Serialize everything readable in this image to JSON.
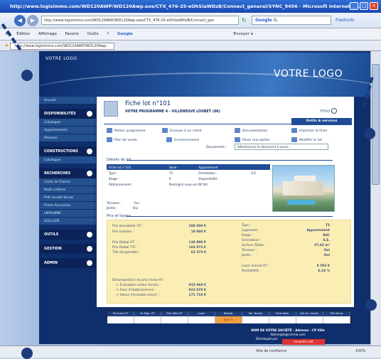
{
  "window": {
    "title": "http://www.logisimmo.com/WD120AWP/WD120Awp.exe/CTX_476-25-eOhSiaWDzB/Connect_general/SYNC_9456 - Microsoft Internet Ex..."
  },
  "nav": {
    "address": "http://www.logisimmo.com/WD120AWP/WD120Awp.exe/CTX_476-25-eOhSiaWDzB/Connect_gen",
    "search_engine": "Google",
    "search_placeholder": "G-",
    "envoyer_label": "Envoyer à",
    "freetools": "freetools"
  },
  "menu": {
    "items": [
      "Édition",
      "Affichage",
      "Favoris",
      "Outils",
      "?"
    ],
    "first": "E"
  },
  "favbar": {
    "tab": "http://www.logisimmo.com/WD120AWP/WD120Awp..."
  },
  "header": {
    "logo_left": "VOTRE LOGO",
    "logo_right": "VOTRE LOGO"
  },
  "sidebar": [
    {
      "type": "item",
      "label": "Accueil"
    },
    {
      "type": "head",
      "label": "DISPONIBILITÉS"
    },
    {
      "type": "item",
      "label": "Catalogue"
    },
    {
      "type": "item",
      "label": "Appartements"
    },
    {
      "type": "item",
      "label": "Maisons"
    },
    {
      "type": "head",
      "label": "CONSTRUCTIONS"
    },
    {
      "type": "item",
      "label": "Catalogue"
    },
    {
      "type": "head",
      "label": "RECHERCHES"
    },
    {
      "type": "item",
      "label": "Carte de France"
    },
    {
      "type": "item",
      "label": "Multi-critères"
    },
    {
      "type": "item",
      "label": "Prêt Locatif Social"
    },
    {
      "type": "item",
      "label": "Primo Accession"
    },
    {
      "type": "item",
      "label": "LMP/LMNP"
    },
    {
      "type": "item",
      "label": "SCELLIER"
    },
    {
      "type": "head",
      "label": "OUTILS"
    },
    {
      "type": "head",
      "label": "GESTION"
    },
    {
      "type": "head",
      "label": "ADMIN"
    }
  ],
  "fiche": {
    "title": "Fiche lot n°101",
    "subtitle": "VOTRE PROGRAMME 4 - VILLENEUVE LOUBET (06)",
    "retour": "retour"
  },
  "outils": {
    "title": "Outils & services",
    "actions": [
      "Retour programme",
      "Envoyer à un client",
      "Documentation",
      "Imprimer la fiche",
      "Plan de vente",
      "Environnement",
      "Poser une option",
      "Modifier le lot"
    ],
    "documents_label": "Documents :",
    "documents_select": "Sélectionnez le document à ouvrir..."
  },
  "details": {
    "title": "Détails du lot",
    "head": [
      "Fiche lot n°101",
      "Serie :",
      "Appartement"
    ],
    "rows": [
      [
        "Type :",
        "T3",
        "Orientation :",
        "S.E."
      ],
      [
        "Etage :",
        "0",
        "Disponibilité :",
        ""
      ],
      [
        "Stationnement :",
        "Parking(s) sous-sol (N°44)",
        "",
        ""
      ]
    ],
    "extra": [
      [
        "Terrasse :",
        "Oui"
      ],
      [
        "Jardin :",
        "Oui"
      ]
    ]
  },
  "prix": {
    "title": "Prix et loyers",
    "left": [
      [
        "Prix Immobilier HT :",
        "108 000 €"
      ],
      [
        "Prix mobilier :",
        "10 000 €"
      ],
      [
        "Prix Global HT :",
        "118 000 €"
      ],
      [
        "Prix Global TTC :",
        "163 873 €"
      ],
      [
        "TVA récupérable :",
        "63 373 €"
      ]
    ],
    "right": [
      [
        "Type :",
        "T3"
      ],
      [
        "Logement :",
        "Appartement"
      ],
      [
        "Etage :",
        "RdC"
      ],
      [
        "Orientation :",
        "S.E."
      ],
      [
        "Surface Totale :",
        "67,62 m²"
      ],
      [
        "Terrasse :",
        "Oui"
      ],
      [
        "Jardin :",
        "Oui"
      ],
      [
        "Loyer annuel HT :",
        "8 502 €"
      ],
      [
        "Rentabilité :",
        "6,24 %"
      ]
    ],
    "decomp_title": "Décomposition du prix immo HT :",
    "decomp": [
      [
        "-> Evaluation valeur terrain :",
        "915 068 €"
      ],
      [
        "-> Frais d'établissement :",
        "923 079 €"
      ],
      [
        "-> Valeur immeuble amort. :",
        "171 716 €"
      ]
    ]
  },
  "bottom_table": {
    "headers": [
      "Px Immo HT",
      "Px Mob. HT",
      "Prix Total HT",
      "Loyer",
      "Rentab.",
      "Val. Terrain",
      "Frais étab.",
      "Val. Im. amort.",
      "TVA récup."
    ],
    "highlight": "6,24 %"
  },
  "footer": {
    "line1": "NOM DE VOTRE SOCIÉTÉ - Adresse - CP Ville",
    "line2": "fabien@logisimmo.com",
    "line3": "Développé par",
    "badge": "européen soft"
  },
  "status": {
    "security": "Site de confiance",
    "zoom": "100%"
  }
}
